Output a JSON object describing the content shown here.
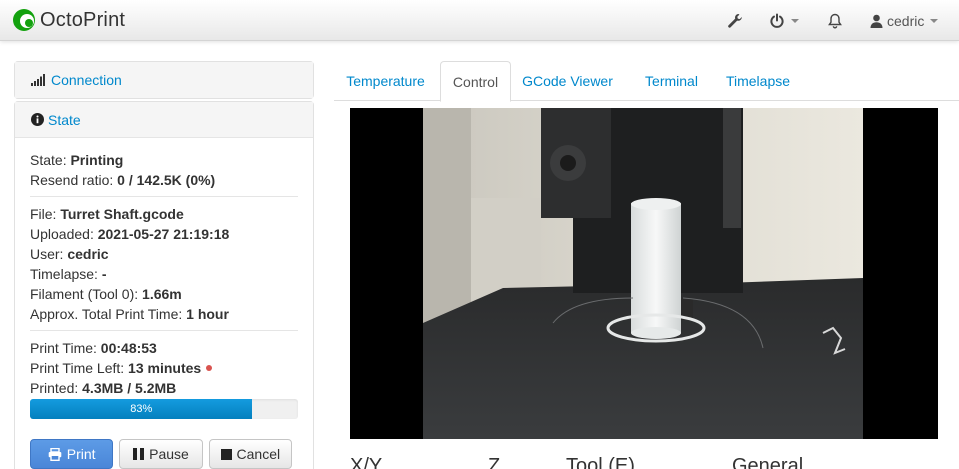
{
  "navbar": {
    "brand": "OctoPrint",
    "user": "cedric",
    "icons": [
      "wrench-icon",
      "power-icon",
      "bell-icon",
      "user-icon"
    ]
  },
  "sidebar": {
    "connection_label": "Connection",
    "state_label": "State",
    "state": {
      "state_label": "State: ",
      "state_value": "Printing",
      "resend_label": "Resend ratio: ",
      "resend_value": "0 / 142.5K (0%)",
      "file_label": "File: ",
      "file_value": "Turret Shaft.gcode",
      "uploaded_label": "Uploaded: ",
      "uploaded_value": "2021-05-27 21:19:18",
      "user_label": "User: ",
      "user_value": "cedric",
      "timelapse_label": "Timelapse: ",
      "timelapse_value": "-",
      "filament_label": "Filament (Tool 0): ",
      "filament_value": "1.66m",
      "approx_label": "Approx. Total Print Time: ",
      "approx_value": "1 hour",
      "print_time_label": "Print Time: ",
      "print_time_value": "00:48:53",
      "time_left_label": "Print Time Left: ",
      "time_left_value": "13 minutes",
      "printed_label": "Printed: ",
      "printed_value": "4.3MB / 5.2MB",
      "progress_text": "83%",
      "progress_fraction": 0.83
    },
    "buttons": {
      "print": "Print",
      "pause": "Pause",
      "cancel": "Cancel"
    }
  },
  "tabs": [
    {
      "label": "Temperature",
      "active": false
    },
    {
      "label": "Control",
      "active": true
    },
    {
      "label": "GCode Viewer",
      "active": false
    },
    {
      "label": "Terminal",
      "active": false
    },
    {
      "label": "Timelapse",
      "active": false
    }
  ],
  "control_sections": [
    "X/Y",
    "Z",
    "Tool (E)",
    "General"
  ],
  "colors": {
    "link": "#0088cc",
    "primary": "#4a86d8",
    "progress": "#0e8fd1",
    "status_dot": "#d9534f",
    "brand_green": "#13a10e"
  }
}
